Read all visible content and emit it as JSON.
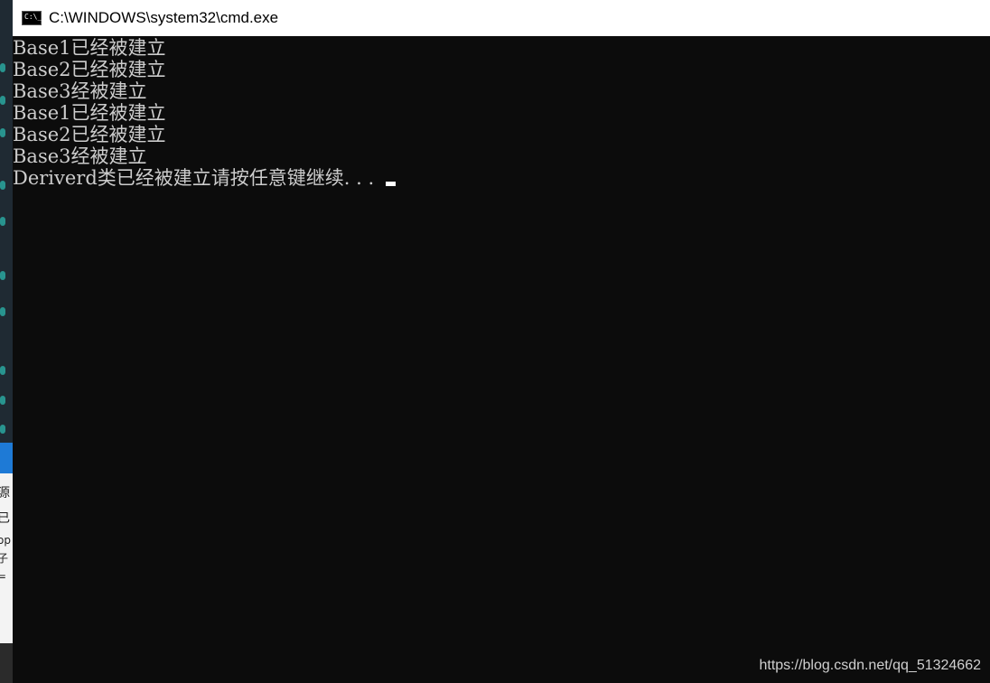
{
  "window": {
    "title": "C:\\WINDOWS\\system32\\cmd.exe",
    "icon": "cmd-icon"
  },
  "console": {
    "lines": [
      "Base1已经被建立",
      "Base2已经被建立",
      "Base3经被建立",
      "Base1已经被建立",
      "Base2已经被建立",
      "Base3经被建立",
      "Deriverd类已经被建立请按任意键继续. . . "
    ]
  },
  "background": {
    "fragments": [
      "源",
      "已",
      "op",
      "子",
      "="
    ]
  },
  "watermark": "https://blog.csdn.net/qq_51324662"
}
